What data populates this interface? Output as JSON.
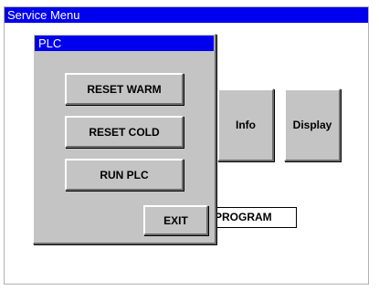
{
  "window": {
    "title": "Service Menu"
  },
  "background_buttons": {
    "info_label": "Info",
    "display_label": "Display",
    "program_field_value": "PROGRAM"
  },
  "dialog": {
    "title": "PLC",
    "reset_warm_label": "RESET WARM",
    "reset_cold_label": "RESET COLD",
    "run_plc_label": "RUN PLC",
    "exit_label": "EXIT"
  },
  "colors": {
    "titlebar": "#0000ee",
    "panel": "#c4c4c4",
    "background": "#ffffff"
  }
}
